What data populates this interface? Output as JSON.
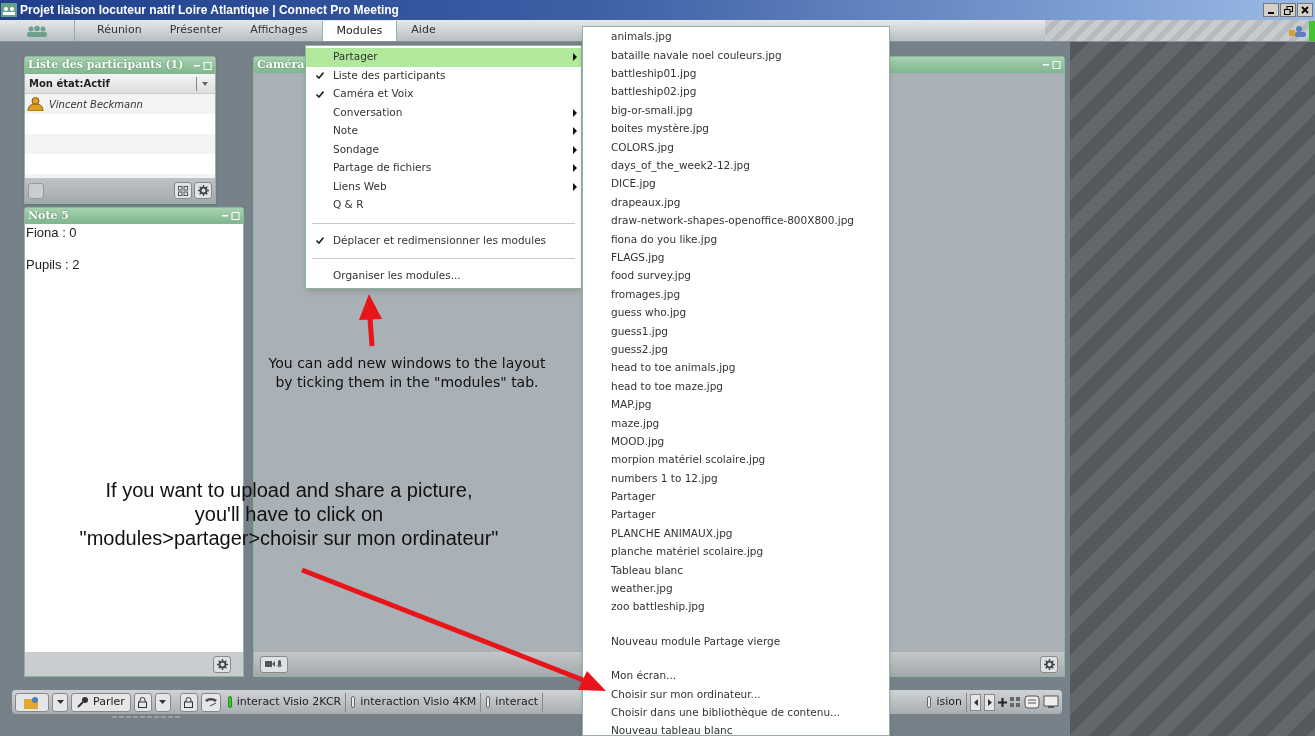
{
  "window": {
    "title": "Projet liaison locuteur natif Loire Atlantique | Connect Pro Meeting"
  },
  "menu_bar": [
    {
      "label": "Réunion",
      "selected": false
    },
    {
      "label": "Présenter",
      "selected": false
    },
    {
      "label": "Affichages",
      "selected": false
    },
    {
      "label": "Modules",
      "selected": true
    },
    {
      "label": "Aide",
      "selected": false
    }
  ],
  "modules_menu": [
    {
      "kind": "item",
      "label": "Partager",
      "checked": false,
      "submenu": true,
      "selected": true
    },
    {
      "kind": "item",
      "label": "Liste des participants",
      "checked": true,
      "submenu": false,
      "selected": false
    },
    {
      "kind": "item",
      "label": "Caméra et Voix",
      "checked": true,
      "submenu": false,
      "selected": false
    },
    {
      "kind": "item",
      "label": "Conversation",
      "checked": false,
      "submenu": true,
      "selected": false
    },
    {
      "kind": "item",
      "label": "Note",
      "checked": false,
      "submenu": true,
      "selected": false
    },
    {
      "kind": "item",
      "label": "Sondage",
      "checked": false,
      "submenu": true,
      "selected": false
    },
    {
      "kind": "item",
      "label": "Partage de fichiers",
      "checked": false,
      "submenu": true,
      "selected": false
    },
    {
      "kind": "item",
      "label": "Liens Web",
      "checked": false,
      "submenu": true,
      "selected": false
    },
    {
      "kind": "item",
      "label": "Q & R",
      "checked": false,
      "submenu": false,
      "selected": false
    },
    {
      "kind": "separator"
    },
    {
      "kind": "item",
      "label": "Déplacer et redimensionner les modules",
      "checked": true,
      "submenu": false,
      "selected": false
    },
    {
      "kind": "separator"
    },
    {
      "kind": "item",
      "label": "Organiser les modules...",
      "checked": false,
      "submenu": false,
      "selected": false
    }
  ],
  "share_submenu": [
    {
      "kind": "item",
      "label": "animals.jpg"
    },
    {
      "kind": "item",
      "label": "bataille navale noel couleurs.jpg"
    },
    {
      "kind": "item",
      "label": "battleship01.jpg"
    },
    {
      "kind": "item",
      "label": "battleship02.jpg"
    },
    {
      "kind": "item",
      "label": "big-or-small.jpg"
    },
    {
      "kind": "item",
      "label": "boites mystère.jpg"
    },
    {
      "kind": "item",
      "label": "COLORS.jpg"
    },
    {
      "kind": "item",
      "label": "days_of_the_week2-12.jpg"
    },
    {
      "kind": "item",
      "label": "DICE.jpg"
    },
    {
      "kind": "item",
      "label": "drapeaux.jpg"
    },
    {
      "kind": "item",
      "label": "draw-network-shapes-openoffice-800X800.jpg"
    },
    {
      "kind": "item",
      "label": "fiona do you like.jpg"
    },
    {
      "kind": "item",
      "label": "FLAGS.jpg"
    },
    {
      "kind": "item",
      "label": "food survey.jpg"
    },
    {
      "kind": "item",
      "label": "fromages.jpg"
    },
    {
      "kind": "item",
      "label": "guess who.jpg"
    },
    {
      "kind": "item",
      "label": "guess1.jpg"
    },
    {
      "kind": "item",
      "label": "guess2.jpg"
    },
    {
      "kind": "item",
      "label": "head to toe animals.jpg"
    },
    {
      "kind": "item",
      "label": "head to toe maze.jpg"
    },
    {
      "kind": "item",
      "label": "MAP.jpg"
    },
    {
      "kind": "item",
      "label": "maze.jpg"
    },
    {
      "kind": "item",
      "label": "MOOD.jpg"
    },
    {
      "kind": "item",
      "label": "morpion matériel scolaire.jpg"
    },
    {
      "kind": "item",
      "label": "numbers 1 to 12.jpg"
    },
    {
      "kind": "item",
      "label": "Partager"
    },
    {
      "kind": "item",
      "label": "Partager"
    },
    {
      "kind": "item",
      "label": "PLANCHE ANIMAUX.jpg"
    },
    {
      "kind": "item",
      "label": "planche matériel scolaire.jpg"
    },
    {
      "kind": "item",
      "label": "Tableau blanc"
    },
    {
      "kind": "item",
      "label": "weather.jpg"
    },
    {
      "kind": "item",
      "label": "zoo battleship.jpg"
    },
    {
      "kind": "separator"
    },
    {
      "kind": "item",
      "label": "Nouveau module Partage vierge"
    },
    {
      "kind": "separator"
    },
    {
      "kind": "item",
      "label": "Mon écran..."
    },
    {
      "kind": "item",
      "label": "Choisir sur mon ordinateur..."
    },
    {
      "kind": "item",
      "label": "Choisir dans une bibliothèque de contenu..."
    },
    {
      "kind": "item",
      "label": "Nouveau tableau blanc"
    }
  ],
  "participants_panel": {
    "title": "Liste des participants (1)",
    "status": "Mon état:Actif",
    "participants": [
      "Vincent Beckmann"
    ]
  },
  "note_panel": {
    "title": "Note 5",
    "lines": [
      "Fiona : 0",
      "Pupils : 2"
    ]
  },
  "camera_panel": {
    "title": "Caméra"
  },
  "taskbar": {
    "talk_button": "Parler",
    "tabs": [
      {
        "label": "interact Visio 2KCR",
        "active": true
      },
      {
        "label": "interaction Visio 4KM",
        "active": false
      },
      {
        "label": "interact",
        "active": false
      }
    ],
    "tabs_right": [
      {
        "label": "ision",
        "active": false
      }
    ]
  },
  "annotations": [
    {
      "text": "You can add new windows to the layout\nby ticking them in the \"modules\" tab."
    },
    {
      "text": "If you want to upload and share a picture,\nyou'll have to click on\n\"modules>partager>choisir sur mon ordinateur\""
    }
  ]
}
